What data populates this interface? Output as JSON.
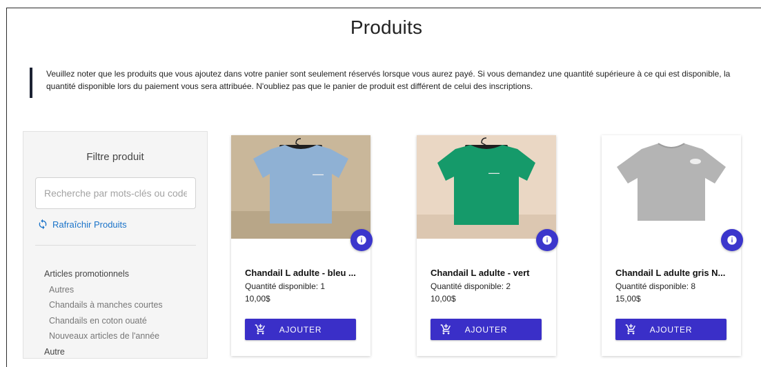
{
  "page": {
    "title": "Produits"
  },
  "notice": {
    "line1": "Veuillez noter que les produits que vous ajoutez dans votre panier sont seulement réservés lorsque vous aurez payé. Si vous demandez une quantité supérieure à ce qui est disponible, la",
    "line2": "quantité disponible lors du paiement vous sera attribuée. N'oubliez pas que le panier de produit est différent de celui des inscriptions."
  },
  "filter": {
    "title": "Filtre produit",
    "search_placeholder": "Recherche par mots-clés ou code l",
    "search_value": "",
    "refresh_label": "Rafraîchir Produits",
    "categories": [
      {
        "label": "Articles promotionnels"
      },
      {
        "label": "Autres"
      },
      {
        "label": "Chandails à manches courtes"
      },
      {
        "label": "Chandails en coton ouaté"
      },
      {
        "label": "Nouveaux articles de l'année"
      },
      {
        "label": "Autre"
      }
    ]
  },
  "products": [
    {
      "name": "Chandail L adulte - bleu ...",
      "quantity": "Quantité disponible: 1",
      "price": "10,00$",
      "add_label": "AJOUTER",
      "shirt_color": "#8fb1d4"
    },
    {
      "name": "Chandail L adulte - vert",
      "quantity": "Quantité disponible: 2",
      "price": "10,00$",
      "add_label": "AJOUTER",
      "shirt_color": "#159a6a"
    },
    {
      "name": "Chandail L adulte gris N...",
      "quantity": "Quantité disponible: 8",
      "price": "15,00$",
      "add_label": "AJOUTER",
      "shirt_color": "#b4b4b4"
    }
  ],
  "colors": {
    "accent": "#3a2fc8",
    "link": "#1a73c9",
    "notice_bar": "#1c2233"
  },
  "icons": [
    "refresh-icon",
    "info-icon",
    "add-to-cart-icon",
    "hanger-icon"
  ]
}
